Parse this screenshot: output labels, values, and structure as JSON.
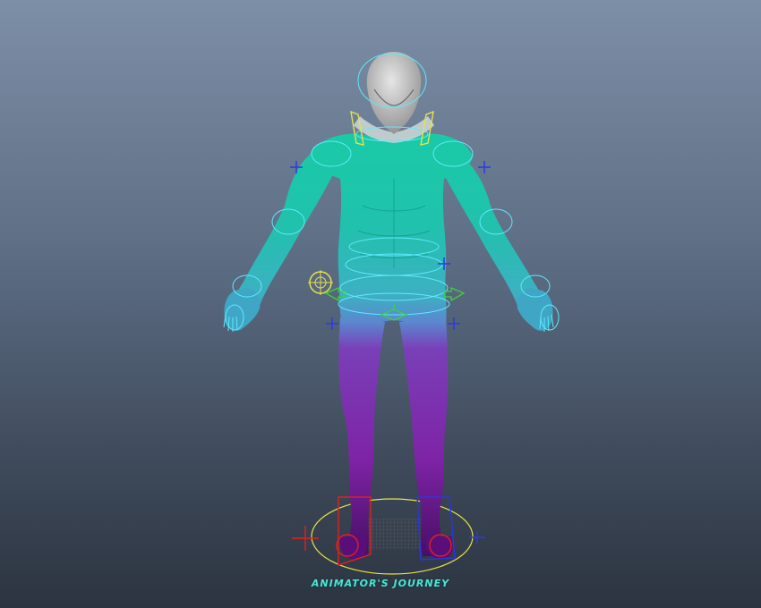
{
  "viewport": {
    "background_top": "#7d8fa6",
    "background_bottom": "#2c3440"
  },
  "character": {
    "body_color_top": "#17c9a8",
    "body_color_mid": "#3aa7c8",
    "body_color_bottom": "#6a1a8f",
    "head_color": "#c7c7c7"
  },
  "controls": {
    "fk_ring_color": "#5ee9ff",
    "ik_left_color": "#e02020",
    "ik_right_color": "#2a36e0",
    "root_color": "#e8e24a",
    "pivot_color": "#3bd23b",
    "pole_color": "#2b3be0"
  },
  "watermark": {
    "text": "ANIMATOR'S JOURNEY"
  }
}
